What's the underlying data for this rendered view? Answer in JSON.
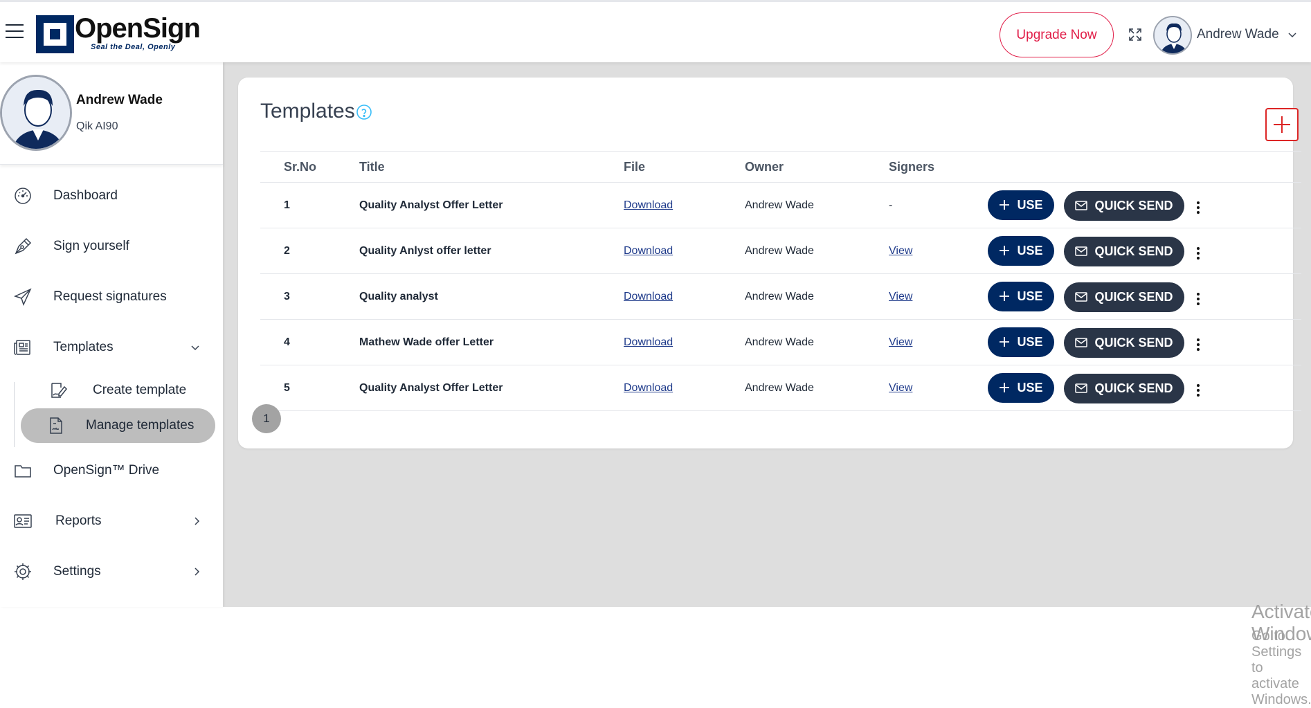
{
  "header": {
    "logo_text": "OpenSign",
    "logo_tagline": "Seal the Deal, Openly",
    "upgrade_label": "Upgrade Now",
    "user_name": "Andrew Wade"
  },
  "profile": {
    "name": "Andrew Wade",
    "org": "Qik AI90"
  },
  "sidebar": {
    "items": [
      {
        "label": "Dashboard",
        "icon": "dashboard-icon"
      },
      {
        "label": "Sign yourself",
        "icon": "pen-icon"
      },
      {
        "label": "Request signatures",
        "icon": "send-icon"
      },
      {
        "label": "Templates",
        "icon": "newspaper-icon"
      },
      {
        "label": "OpenSign™ Drive",
        "icon": "folder-icon"
      },
      {
        "label": "Reports",
        "icon": "id-card-icon"
      },
      {
        "label": "Settings",
        "icon": "gear-icon"
      }
    ],
    "templates_sub": [
      {
        "label": "Create template",
        "icon": "signature-icon"
      },
      {
        "label": "Manage templates",
        "icon": "file-signature-icon",
        "active": true
      }
    ]
  },
  "main": {
    "title": "Templates",
    "columns": [
      "Sr.No",
      "Title",
      "File",
      "Owner",
      "Signers"
    ],
    "rows": [
      {
        "no": "1",
        "title": "Quality Analyst Offer Letter",
        "file": "Download",
        "owner": "Andrew Wade",
        "signers": "-"
      },
      {
        "no": "2",
        "title": "Quality Anlyst offer letter",
        "file": "Download",
        "owner": "Andrew Wade",
        "signers": "View"
      },
      {
        "no": "3",
        "title": "Quality analyst",
        "file": "Download",
        "owner": "Andrew Wade",
        "signers": "View"
      },
      {
        "no": "4",
        "title": "Mathew Wade offer Letter",
        "file": "Download",
        "owner": "Andrew Wade",
        "signers": "View"
      },
      {
        "no": "5",
        "title": "Quality Analyst Offer Letter",
        "file": "Download",
        "owner": "Andrew Wade",
        "signers": "View"
      }
    ],
    "use_label": "USE",
    "quick_send_label": "QUICK SEND",
    "page": "1"
  },
  "watermark": {
    "line1": "Activate Windows",
    "line2": "Go to Settings to activate Windows."
  },
  "colors": {
    "brand": "#002862",
    "accent": "#e11d48",
    "quick_send": "#2a3547",
    "background": "#dedede"
  }
}
